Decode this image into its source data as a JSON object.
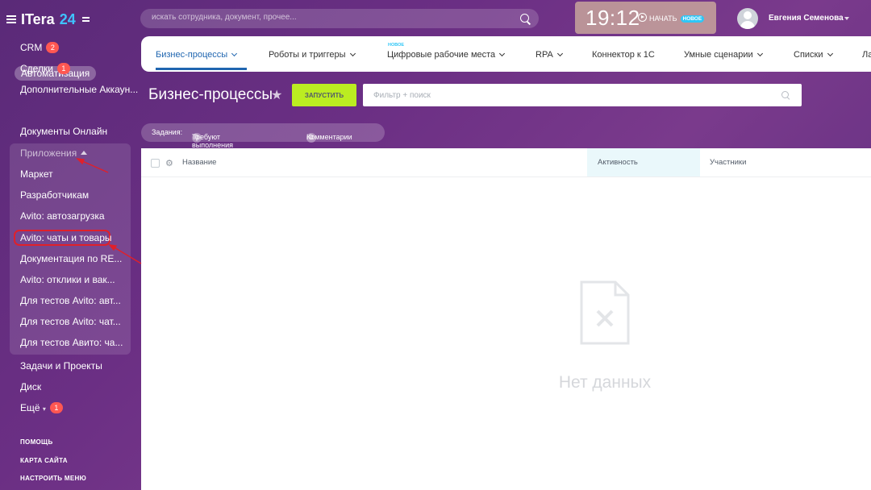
{
  "app": {
    "logo_text": "ITera",
    "logo_num": "24"
  },
  "sidebar": {
    "items": [
      {
        "label": "CRM",
        "badge": "2"
      },
      {
        "label": "Сделки",
        "badge": "1"
      },
      {
        "label": "Дополнительные Аккаун..."
      },
      {
        "label": "Автоматизация"
      },
      {
        "label": "Документы Онлайн"
      }
    ],
    "apps_header": "Приложения",
    "apps": [
      "Маркет",
      "Разработчикам",
      "Avito: автозагрузка",
      "Avito: чаты и товары",
      "Документация по RE...",
      "Avito: отклики и вак...",
      "Для тестов Avito: авт...",
      "Для тестов Avito: чат...",
      "Для тестов Авито: ча..."
    ],
    "bottom": [
      {
        "label": "Задачи и Проекты"
      },
      {
        "label": "Диск"
      },
      {
        "label": "Ещё",
        "badge": "1"
      }
    ],
    "footer": [
      "ПОМОЩЬ",
      "КАРТА САЙТА",
      "НАСТРОИТЬ МЕНЮ"
    ]
  },
  "header": {
    "search_placeholder": "искать сотрудника, документ, прочее...",
    "time": "19:12",
    "start_label": "НАЧАТЬ",
    "new_badge": "НОВОЕ",
    "user_name": "Евгения Семенова"
  },
  "tabs": {
    "new_label": "НОВОЕ",
    "items": [
      "Бизнес-процессы",
      "Роботы и триггеры",
      "Цифровые рабочие места",
      "RPA",
      "Коннектор к 1С",
      "Умные сценарии",
      "Списки",
      "Ла"
    ]
  },
  "page": {
    "title": "Бизнес-процессы",
    "run_button": "ЗАПУСТИТЬ",
    "filter_placeholder": "Фильтр + поиск",
    "tasks_label": "Задания:",
    "tasks_required_count": "0",
    "tasks_required_label": "Требуют выполнения",
    "comments_count": "0",
    "comments_label": "Комментарии"
  },
  "grid": {
    "columns": [
      "Название",
      "Активность",
      "Участники"
    ],
    "empty_text": "Нет данных"
  },
  "colors": {
    "accent": "#2066b0",
    "run_button": "#bbed21",
    "badge": "#ff5752",
    "annotation": "#e0202a"
  }
}
